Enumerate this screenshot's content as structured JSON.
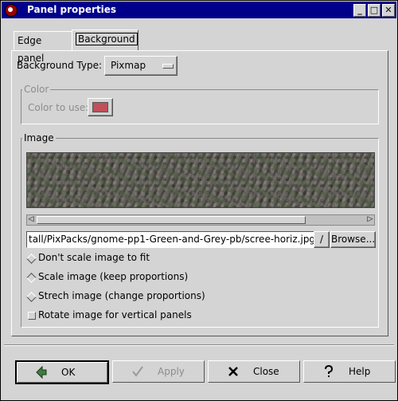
{
  "window": {
    "title": "Panel properties"
  },
  "title_buttons": {
    "minimize": "_",
    "maximize": "□",
    "close": "✕"
  },
  "tabs": [
    {
      "label": "Edge panel"
    },
    {
      "label": "Background"
    }
  ],
  "background_type": {
    "label": "Background Type:",
    "value": "Pixmap"
  },
  "color_frame": {
    "title": "Color",
    "label": "Color to use:",
    "swatch": "#c0505a"
  },
  "image_frame": {
    "title": "Image",
    "path": "tall/PixPacks/gnome-pp1-Green-and-Grey-pb/scree-horiz.jpg",
    "slash_label": "/",
    "browse_label": "Browse..."
  },
  "options": [
    {
      "label": "Don't scale image to fit"
    },
    {
      "label": "Scale image (keep proportions)"
    },
    {
      "label": "Strech image (change proportions)"
    },
    {
      "label": "Rotate image for vertical panels"
    }
  ],
  "buttons": {
    "ok": "OK",
    "apply": "Apply",
    "close": "Close",
    "help": "Help"
  },
  "colors": {
    "titlebar": "#00008b",
    "dialog": "#d4d4d4"
  }
}
